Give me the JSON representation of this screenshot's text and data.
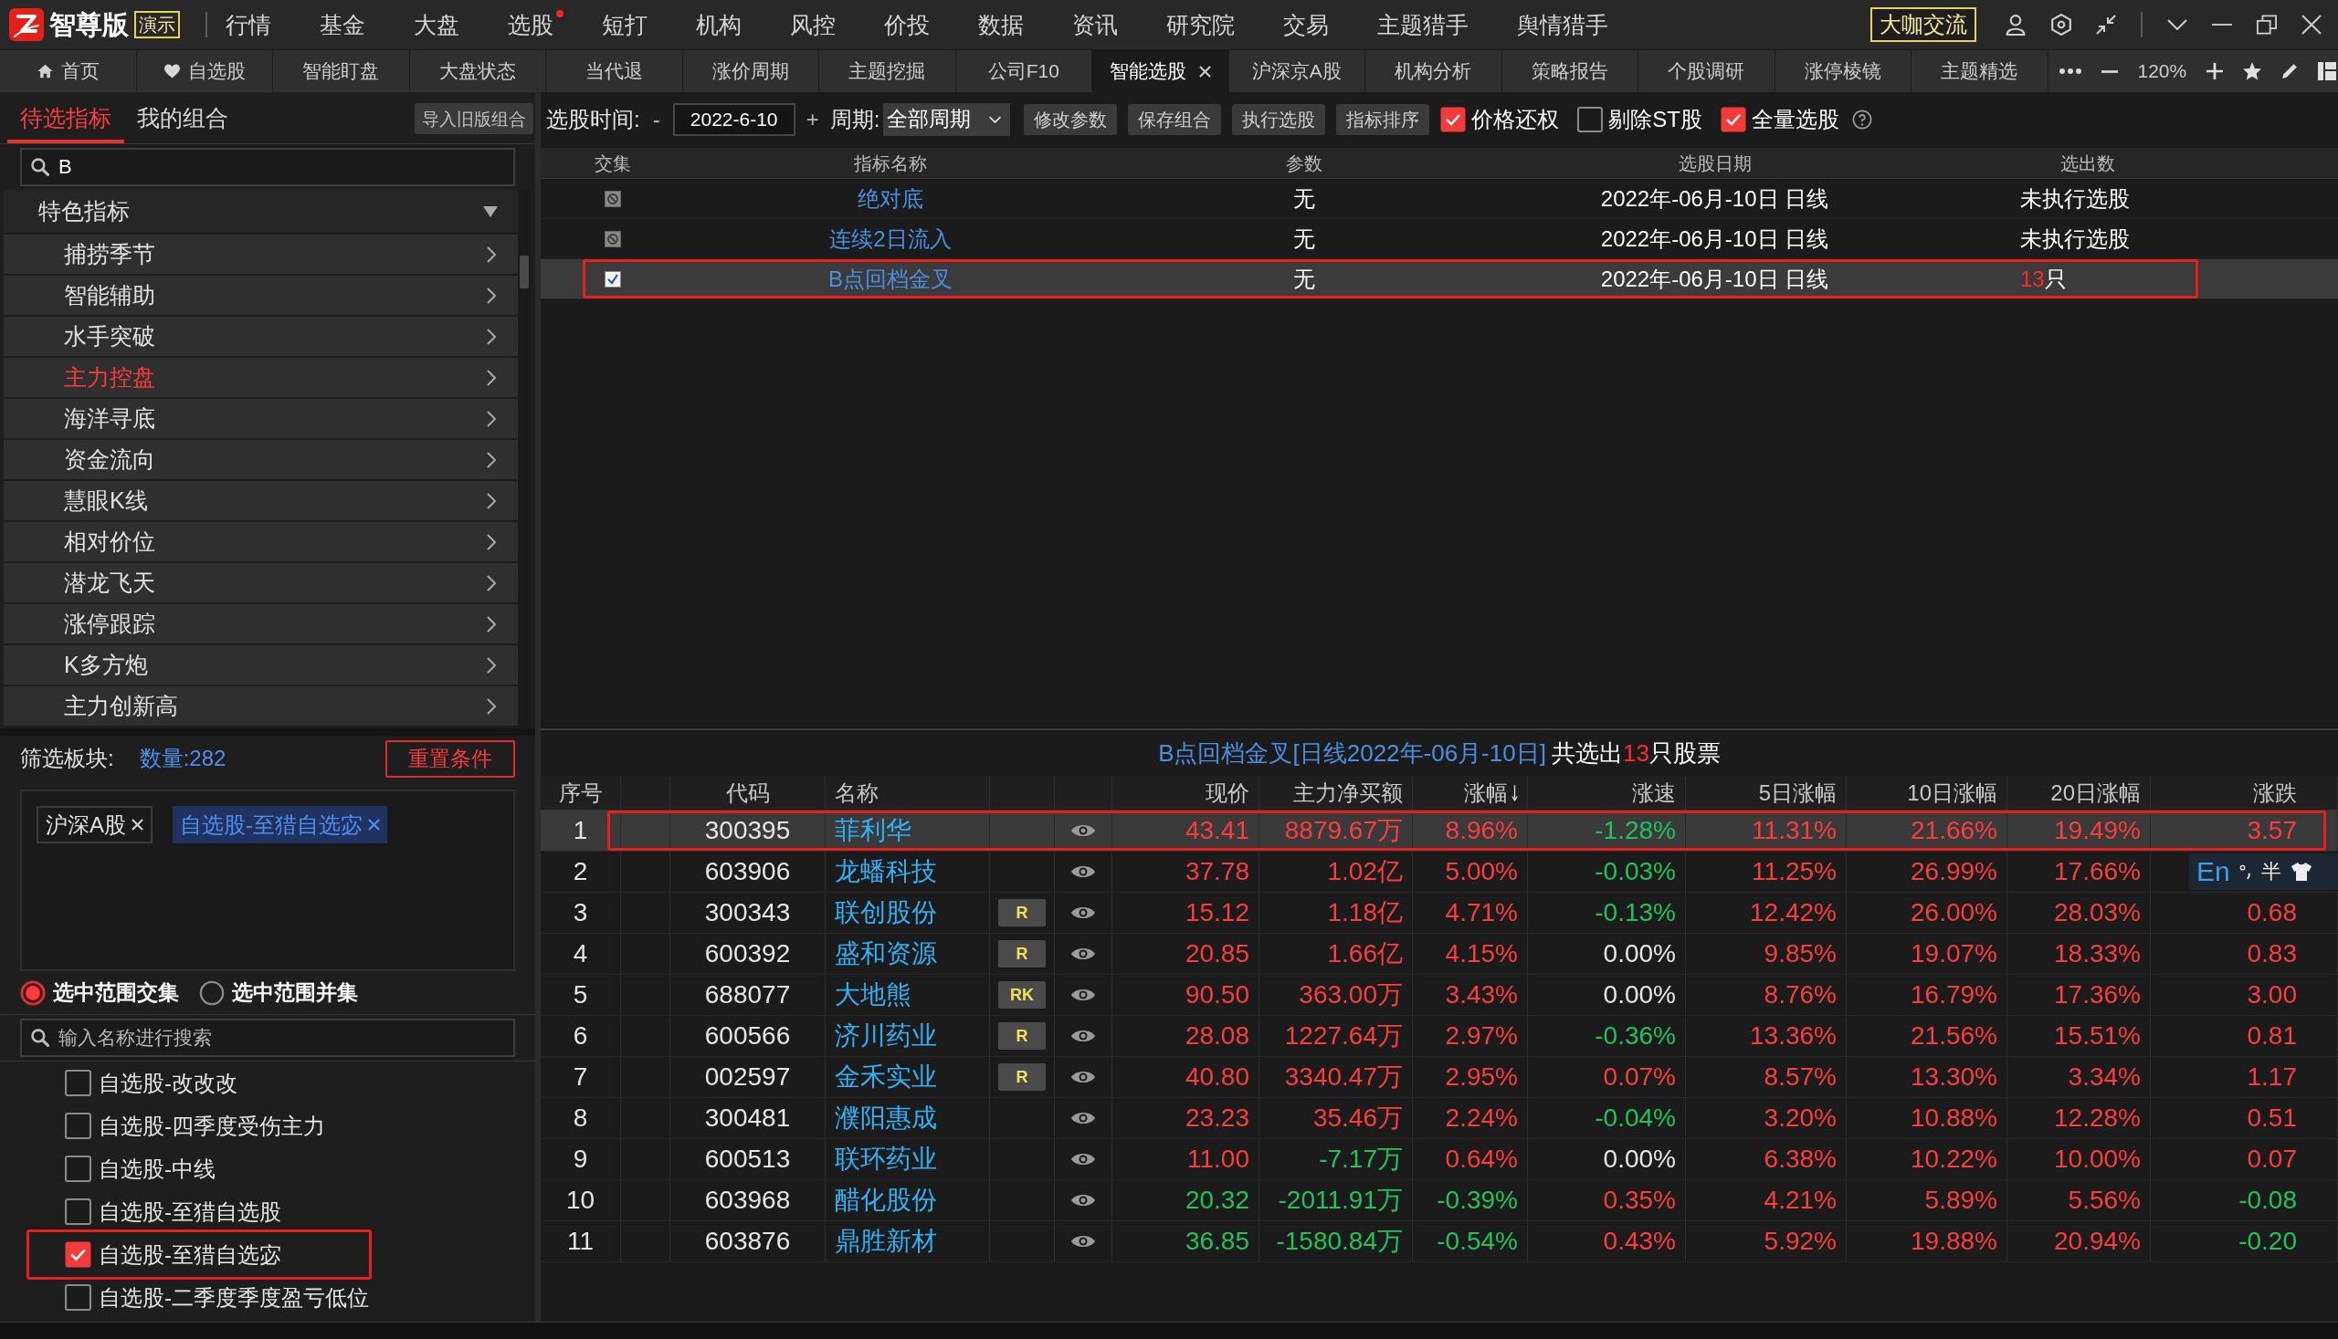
{
  "title_bar": {
    "brand": "智尊版",
    "edition": "演示",
    "menu": [
      {
        "label": "行情",
        "dot": false
      },
      {
        "label": "基金",
        "dot": false
      },
      {
        "label": "大盘",
        "dot": false
      },
      {
        "label": "选股",
        "dot": true
      },
      {
        "label": "短打",
        "dot": false
      },
      {
        "label": "机构",
        "dot": false
      },
      {
        "label": "风控",
        "dot": false
      },
      {
        "label": "价投",
        "dot": false
      },
      {
        "label": "数据",
        "dot": false
      },
      {
        "label": "资讯",
        "dot": false
      },
      {
        "label": "研究院",
        "dot": false
      },
      {
        "label": "交易",
        "dot": false
      },
      {
        "label": "主题猎手",
        "dot": false
      },
      {
        "label": "舆情猎手",
        "dot": false
      }
    ],
    "community_button": "大咖交流"
  },
  "tabs": [
    {
      "label": "首页",
      "kind": "home",
      "selected": false
    },
    {
      "label": "自选股",
      "kind": "favorites",
      "selected": false
    },
    {
      "label": "智能盯盘",
      "kind": "plain",
      "selected": false
    },
    {
      "label": "大盘状态",
      "kind": "plain",
      "selected": false
    },
    {
      "label": "当代退",
      "kind": "plain",
      "selected": false
    },
    {
      "label": "涨价周期",
      "kind": "plain",
      "selected": false
    },
    {
      "label": "主题挖掘",
      "kind": "plain",
      "selected": false
    },
    {
      "label": "公司F10",
      "kind": "plain",
      "selected": false
    },
    {
      "label": "智能选股",
      "kind": "plain",
      "selected": true
    },
    {
      "label": "沪深京A股",
      "kind": "plain",
      "selected": false
    },
    {
      "label": "机构分析",
      "kind": "plain",
      "selected": false
    },
    {
      "label": "策略报告",
      "kind": "plain",
      "selected": false
    },
    {
      "label": "个股调研",
      "kind": "plain",
      "selected": false
    },
    {
      "label": "涨停棱镜",
      "kind": "plain",
      "selected": false
    },
    {
      "label": "主题精选",
      "kind": "plain",
      "selected": false
    }
  ],
  "zoom_level": "120%",
  "left_panel": {
    "tabs": [
      {
        "label": "待选指标",
        "selected": true
      },
      {
        "label": "我的组合",
        "selected": false
      }
    ],
    "import_button": "导入旧版组合",
    "search": {
      "value": "B"
    },
    "category": {
      "label": "特色指标",
      "expanded": true,
      "children": [
        {
          "label": "捕捞季节",
          "selected": false
        },
        {
          "label": "智能辅助",
          "selected": false
        },
        {
          "label": "水手突破",
          "selected": false
        },
        {
          "label": "主力控盘",
          "selected": true
        },
        {
          "label": "海洋寻底",
          "selected": false
        },
        {
          "label": "资金流向",
          "selected": false
        },
        {
          "label": "慧眼K线",
          "selected": false
        },
        {
          "label": "相对价位",
          "selected": false
        },
        {
          "label": "潜龙飞天",
          "selected": false
        },
        {
          "label": "涨停跟踪",
          "selected": false
        },
        {
          "label": "K多方炮",
          "selected": false
        },
        {
          "label": "主力创新高",
          "selected": false
        }
      ]
    }
  },
  "filter": {
    "label": "筛选板块:",
    "count": "数量:282",
    "reset_button": "重置条件",
    "tags": [
      {
        "label": "沪深A股",
        "kind": "market"
      },
      {
        "label": "自选股-至猎自选宓",
        "kind": "group"
      }
    ],
    "scope": [
      {
        "label": "选中范围交集",
        "selected": true
      },
      {
        "label": "选中范围并集",
        "selected": false
      }
    ],
    "search": {
      "placeholder": "输入名称进行搜索"
    },
    "groups": [
      {
        "label": "自选股-改改改",
        "checked": false,
        "annotated": false
      },
      {
        "label": "自选股-四季度受伤主力",
        "checked": false,
        "annotated": false
      },
      {
        "label": "自选股-中线",
        "checked": false,
        "annotated": false
      },
      {
        "label": "自选股-至猎自选股",
        "checked": false,
        "annotated": false
      },
      {
        "label": "自选股-至猎自选宓",
        "checked": true,
        "annotated": true
      },
      {
        "label": "自选股-二季度季度盈亏低位",
        "checked": false,
        "annotated": false
      }
    ]
  },
  "toolbar": {
    "date_label": "选股时间:",
    "decrement": "-",
    "date": "2022-6-10",
    "increment": "+",
    "period_label": "周期:",
    "period": "全部周期",
    "buttons": [
      "修改参数",
      "保存组合",
      "执行选股",
      "指标排序"
    ],
    "options": [
      {
        "label": "价格还权",
        "checked": true
      },
      {
        "label": "剔除ST股",
        "checked": false
      },
      {
        "label": "全量选股",
        "checked": true
      }
    ]
  },
  "indicator_table": {
    "columns": [
      "交集",
      "指标名称",
      "参数",
      "选股日期",
      "选出数"
    ],
    "rows": [
      {
        "checked": false,
        "disabled": true,
        "name": "绝对底",
        "param": "无",
        "date": "2022年-06月-10日 日线",
        "result": {
          "kind": "status",
          "text": "未执行选股"
        },
        "selected": false,
        "annotated": false
      },
      {
        "checked": false,
        "disabled": true,
        "name": "连续2日流入",
        "param": "无",
        "date": "2022年-06月-10日 日线",
        "result": {
          "kind": "status",
          "text": "未执行选股"
        },
        "selected": false,
        "annotated": false
      },
      {
        "checked": true,
        "disabled": false,
        "name": "B点回档金叉",
        "param": "无",
        "date": "2022年-06月-10日 日线",
        "result": {
          "kind": "count",
          "count": "13",
          "unit": "只"
        },
        "selected": true,
        "annotated": true
      }
    ]
  },
  "results": {
    "title": {
      "indicator": "B点回档金叉[日线2022年-06月-10日]",
      "prefix": "共选出",
      "count": "13",
      "suffix": "只股票"
    },
    "columns": [
      {
        "label": "序号",
        "sorted": false
      },
      {
        "label": "代码",
        "sorted": false
      },
      {
        "label": "名称",
        "sorted": false
      },
      {
        "label": "现价",
        "sorted": false
      },
      {
        "label": "主力净买额",
        "sorted": false
      },
      {
        "label": "涨幅",
        "sorted": true
      },
      {
        "label": "涨速",
        "sorted": false
      },
      {
        "label": "5日涨幅",
        "sorted": false
      },
      {
        "label": "10日涨幅",
        "sorted": false
      },
      {
        "label": "20日涨幅",
        "sorted": false
      },
      {
        "label": "涨跌",
        "sorted": false
      }
    ],
    "rows": [
      {
        "index": "1",
        "code": "300395",
        "name": "菲利华",
        "selected": true,
        "annotated": true,
        "values": [
          {
            "text": "43.41",
            "kind": "up"
          },
          {
            "text": "8879.67万",
            "kind": "up"
          },
          {
            "text": "8.96%",
            "kind": "up"
          },
          {
            "text": "-1.28%",
            "kind": "down"
          },
          {
            "text": "11.31%",
            "kind": "up"
          },
          {
            "text": "21.66%",
            "kind": "up"
          },
          {
            "text": "19.49%",
            "kind": "up"
          },
          {
            "text": "3.57",
            "kind": "up"
          }
        ]
      },
      {
        "index": "2",
        "code": "603906",
        "name": "龙蟠科技",
        "selected": false,
        "annotated": false,
        "values": [
          {
            "text": "37.78",
            "kind": "up"
          },
          {
            "text": "1.02亿",
            "kind": "up"
          },
          {
            "text": "5.00%",
            "kind": "up"
          },
          {
            "text": "-0.03%",
            "kind": "down"
          },
          {
            "text": "11.25%",
            "kind": "up"
          },
          {
            "text": "26.99%",
            "kind": "up"
          },
          {
            "text": "17.66%",
            "kind": "up"
          }
        ]
      },
      {
        "index": "3",
        "code": "300343",
        "name": "联创股份",
        "badge": "R",
        "selected": false,
        "annotated": false,
        "values": [
          {
            "text": "15.12",
            "kind": "up"
          },
          {
            "text": "1.18亿",
            "kind": "up"
          },
          {
            "text": "4.71%",
            "kind": "up"
          },
          {
            "text": "-0.13%",
            "kind": "down"
          },
          {
            "text": "12.42%",
            "kind": "up"
          },
          {
            "text": "26.00%",
            "kind": "up"
          },
          {
            "text": "28.03%",
            "kind": "up"
          },
          {
            "text": "0.68",
            "kind": "up"
          }
        ]
      },
      {
        "index": "4",
        "code": "600392",
        "name": "盛和资源",
        "badge": "R",
        "selected": false,
        "annotated": false,
        "values": [
          {
            "text": "20.85",
            "kind": "up"
          },
          {
            "text": "1.66亿",
            "kind": "up"
          },
          {
            "text": "4.15%",
            "kind": "up"
          },
          {
            "text": "0.00%",
            "kind": "flat"
          },
          {
            "text": "9.85%",
            "kind": "up"
          },
          {
            "text": "19.07%",
            "kind": "up"
          },
          {
            "text": "18.33%",
            "kind": "up"
          },
          {
            "text": "0.83",
            "kind": "up"
          }
        ]
      },
      {
        "index": "5",
        "code": "688077",
        "name": "大地熊",
        "badge": "RK",
        "selected": false,
        "annotated": false,
        "values": [
          {
            "text": "90.50",
            "kind": "up"
          },
          {
            "text": "363.00万",
            "kind": "up"
          },
          {
            "text": "3.43%",
            "kind": "up"
          },
          {
            "text": "0.00%",
            "kind": "flat"
          },
          {
            "text": "8.76%",
            "kind": "up"
          },
          {
            "text": "16.79%",
            "kind": "up"
          },
          {
            "text": "17.36%",
            "kind": "up"
          },
          {
            "text": "3.00",
            "kind": "up"
          }
        ]
      },
      {
        "index": "6",
        "code": "600566",
        "name": "济川药业",
        "badge": "R",
        "selected": false,
        "annotated": false,
        "values": [
          {
            "text": "28.08",
            "kind": "up"
          },
          {
            "text": "1227.64万",
            "kind": "up"
          },
          {
            "text": "2.97%",
            "kind": "up"
          },
          {
            "text": "-0.36%",
            "kind": "down"
          },
          {
            "text": "13.36%",
            "kind": "up"
          },
          {
            "text": "21.56%",
            "kind": "up"
          },
          {
            "text": "15.51%",
            "kind": "up"
          },
          {
            "text": "0.81",
            "kind": "up"
          }
        ]
      },
      {
        "index": "7",
        "code": "002597",
        "name": "金禾实业",
        "badge": "R",
        "selected": false,
        "annotated": false,
        "values": [
          {
            "text": "40.80",
            "kind": "up"
          },
          {
            "text": "3340.47万",
            "kind": "up"
          },
          {
            "text": "2.95%",
            "kind": "up"
          },
          {
            "text": "0.07%",
            "kind": "up"
          },
          {
            "text": "8.57%",
            "kind": "up"
          },
          {
            "text": "13.30%",
            "kind": "up"
          },
          {
            "text": "3.34%",
            "kind": "up"
          },
          {
            "text": "1.17",
            "kind": "up"
          }
        ]
      },
      {
        "index": "8",
        "code": "300481",
        "name": "濮阳惠成",
        "selected": false,
        "annotated": false,
        "values": [
          {
            "text": "23.23",
            "kind": "up"
          },
          {
            "text": "35.46万",
            "kind": "up"
          },
          {
            "text": "2.24%",
            "kind": "up"
          },
          {
            "text": "-0.04%",
            "kind": "down"
          },
          {
            "text": "3.20%",
            "kind": "up"
          },
          {
            "text": "10.88%",
            "kind": "up"
          },
          {
            "text": "12.28%",
            "kind": "up"
          },
          {
            "text": "0.51",
            "kind": "up"
          }
        ]
      },
      {
        "index": "9",
        "code": "600513",
        "name": "联环药业",
        "selected": false,
        "annotated": false,
        "values": [
          {
            "text": "11.00",
            "kind": "up"
          },
          {
            "text": "-7.17万",
            "kind": "down"
          },
          {
            "text": "0.64%",
            "kind": "up"
          },
          {
            "text": "0.00%",
            "kind": "flat"
          },
          {
            "text": "6.38%",
            "kind": "up"
          },
          {
            "text": "10.22%",
            "kind": "up"
          },
          {
            "text": "10.00%",
            "kind": "up"
          },
          {
            "text": "0.07",
            "kind": "up"
          }
        ]
      },
      {
        "index": "10",
        "code": "603968",
        "name": "醋化股份",
        "selected": false,
        "annotated": false,
        "values": [
          {
            "text": "20.32",
            "kind": "down"
          },
          {
            "text": "-2011.91万",
            "kind": "down"
          },
          {
            "text": "-0.39%",
            "kind": "down"
          },
          {
            "text": "0.35%",
            "kind": "up"
          },
          {
            "text": "4.21%",
            "kind": "up"
          },
          {
            "text": "5.89%",
            "kind": "up"
          },
          {
            "text": "5.56%",
            "kind": "up"
          },
          {
            "text": "-0.08",
            "kind": "down"
          }
        ]
      },
      {
        "index": "11",
        "code": "603876",
        "name": "鼎胜新材",
        "selected": false,
        "annotated": false,
        "values": [
          {
            "text": "36.85",
            "kind": "down"
          },
          {
            "text": "-1580.84万",
            "kind": "down"
          },
          {
            "text": "-0.54%",
            "kind": "down"
          },
          {
            "text": "0.43%",
            "kind": "up"
          },
          {
            "text": "5.92%",
            "kind": "up"
          },
          {
            "text": "19.88%",
            "kind": "up"
          },
          {
            "text": "20.94%",
            "kind": "up"
          },
          {
            "text": "-0.20",
            "kind": "down"
          }
        ]
      }
    ]
  },
  "ime_bar": {
    "mode": "En",
    "shape_mode": "半"
  }
}
